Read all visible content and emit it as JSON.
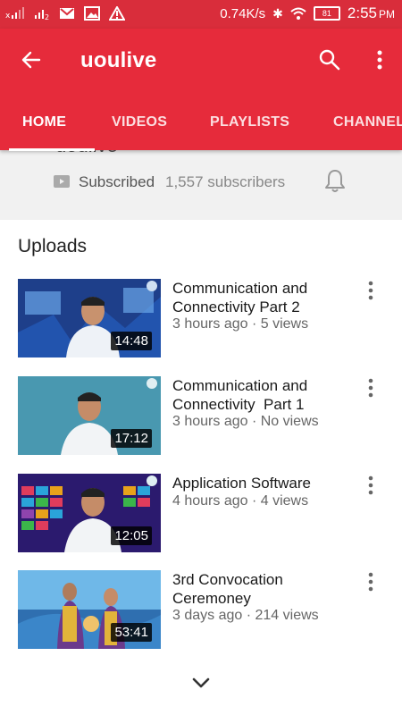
{
  "status": {
    "speed": "0.74K/s",
    "battery": "81",
    "time": "2:55",
    "ampm": "PM"
  },
  "header": {
    "title": "uoulive",
    "tabs": [
      "HOME",
      "VIDEOS",
      "PLAYLISTS",
      "CHANNEL"
    ]
  },
  "channel": {
    "cut_name": "uoulive",
    "subscribed_label": "Subscribed",
    "subscribers": "1,557 subscribers"
  },
  "uploads": {
    "title": "Uploads",
    "videos": [
      {
        "title_line1": "Communication and",
        "title_line2": "Connectivity Part 2",
        "meta": "3 hours ago · 5 views",
        "duration": "14:48"
      },
      {
        "title_line1": "Communication and",
        "title_line2": "Connectivity  Part 1",
        "meta": "3 hours ago · No views",
        "duration": "17:12"
      },
      {
        "title_line1": "Application Software",
        "title_line2": "",
        "meta": "4 hours ago · 4 views",
        "duration": "12:05"
      },
      {
        "title_line1": "3rd Convocation",
        "title_line2": "Ceremoney",
        "meta": "3 days ago · 214 views",
        "duration": "53:41"
      }
    ]
  },
  "colors": {
    "header": "#e62b3b",
    "status": "#d92d3b"
  }
}
